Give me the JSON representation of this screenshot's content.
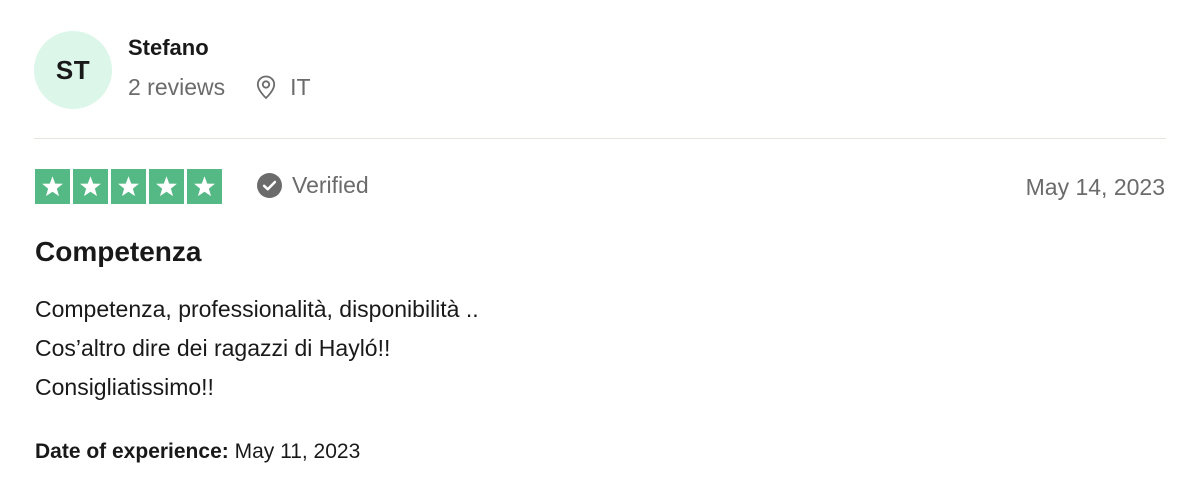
{
  "reviewer": {
    "initials": "ST",
    "name": "Stefano",
    "reviews_count": "2 reviews",
    "location_icon": "location-pin-icon",
    "country": "IT",
    "avatar_color": "#dcf7ea"
  },
  "rating": {
    "stars": 5,
    "max_stars": 5,
    "star_color": "#54b985",
    "verified_icon": "check-circle-icon",
    "verified_label": "Verified",
    "date": "May 14, 2023"
  },
  "review": {
    "title": "Competenza",
    "lines": [
      "Competenza, professionalità, disponibilità ..",
      "Cos’altro dire dei ragazzi di Hayló!!",
      "Consigliatissimo!!"
    ]
  },
  "experience": {
    "label": "Date of experience:",
    "date": " May 11, 2023"
  }
}
